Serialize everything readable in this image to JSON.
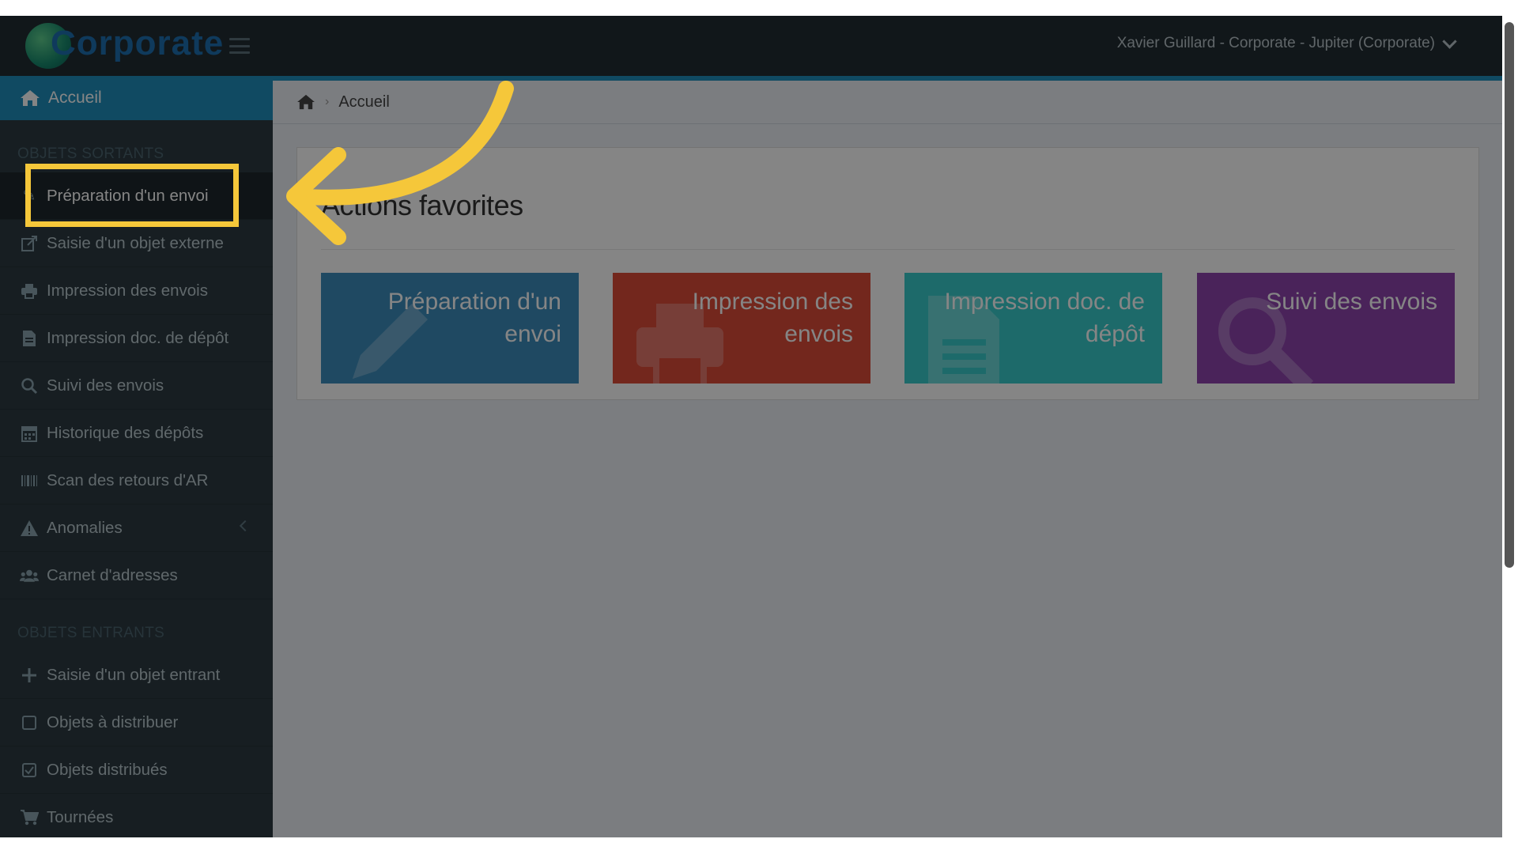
{
  "header": {
    "logo_text": "Corporate",
    "user_label": "Xavier Guillard - Corporate - Jupiter (Corporate)"
  },
  "sidebar": {
    "home_label": "Accueil",
    "sections": [
      {
        "title": "OBJETS SORTANTS",
        "items": [
          {
            "label": "Préparation d'un envoi",
            "icon": "pencil-icon"
          },
          {
            "label": "Saisie d'un objet externe",
            "icon": "external-edit-icon"
          },
          {
            "label": "Impression des envois",
            "icon": "printer-icon"
          },
          {
            "label": "Impression doc. de dépôt",
            "icon": "document-icon"
          },
          {
            "label": "Suivi des envois",
            "icon": "search-icon"
          },
          {
            "label": "Historique des dépôts",
            "icon": "calendar-icon"
          },
          {
            "label": "Scan des retours d'AR",
            "icon": "barcode-icon"
          },
          {
            "label": "Anomalies",
            "icon": "warning-icon"
          },
          {
            "label": "Carnet d'adresses",
            "icon": "users-icon"
          }
        ]
      },
      {
        "title": "OBJETS ENTRANTS",
        "items": [
          {
            "label": "Saisie d'un objet entrant",
            "icon": "plus-icon"
          },
          {
            "label": "Objets à distribuer",
            "icon": "checkbox-empty-icon"
          },
          {
            "label": "Objets distribués",
            "icon": "checkbox-checked-icon"
          },
          {
            "label": "Tournées",
            "icon": "cart-icon"
          }
        ]
      }
    ]
  },
  "breadcrumb": {
    "home_icon": "home-icon",
    "current": "Accueil"
  },
  "panel": {
    "title": "Actions favorites",
    "tiles": [
      {
        "label": "Préparation d'un envoi",
        "color": "#3c8dbc",
        "icon": "pencil-icon"
      },
      {
        "label": "Impression des envois",
        "color": "#dd4b39",
        "icon": "printer-icon"
      },
      {
        "label": "Impression doc. de dépôt",
        "color": "#39cccc",
        "icon": "document-icon"
      },
      {
        "label": "Suivi des envois",
        "color": "#8e44ad",
        "icon": "search-icon"
      }
    ]
  },
  "annotation": {
    "highlight_color": "#f5c73a"
  }
}
